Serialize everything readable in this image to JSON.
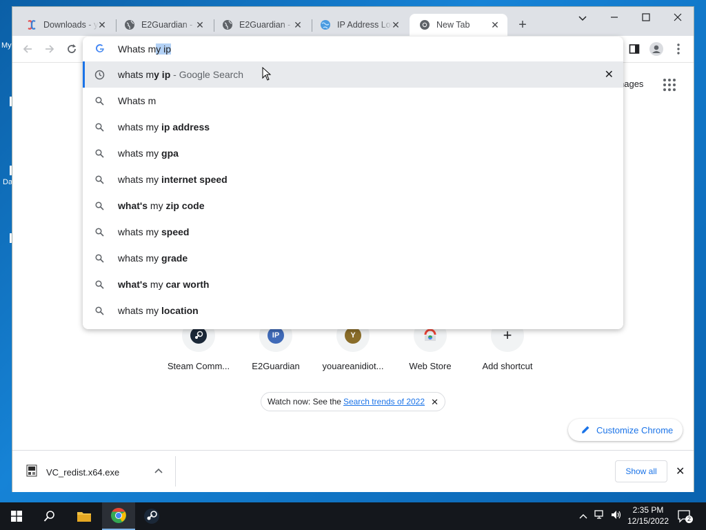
{
  "desktop": {
    "icon_labels": [
      "My",
      "Da"
    ]
  },
  "tabs": [
    {
      "title": "Downloads - y",
      "icon": "downloads-app-icon"
    },
    {
      "title": "E2Guardian - U",
      "icon": "globe-icon"
    },
    {
      "title": "E2Guardian - U",
      "icon": "globe-icon"
    },
    {
      "title": "IP Address Loc",
      "icon": "ip-globe-icon"
    },
    {
      "title": "New Tab",
      "icon": "chrome-icon"
    }
  ],
  "omnibox": {
    "typed": "Whats m",
    "autocomplete_selected": "y ip",
    "suggestions": [
      {
        "icon": "history-clock-icon",
        "prefix": "whats m",
        "bold": "y ip",
        "suffix": " - Google Search",
        "highlighted": true
      },
      {
        "icon": "search-icon",
        "prefix": "Whats m",
        "bold": "",
        "suffix": ""
      },
      {
        "icon": "search-icon",
        "prefix": "whats m",
        "plain_mid": "y ",
        "bold": "ip address",
        "suffix": ""
      },
      {
        "icon": "search-icon",
        "prefix": "whats m",
        "plain_mid": "y ",
        "bold": "gpa",
        "suffix": ""
      },
      {
        "icon": "search-icon",
        "prefix": "whats m",
        "plain_mid": "y ",
        "bold": "internet speed",
        "suffix": ""
      },
      {
        "icon": "search-icon",
        "bold_pre": "what's ",
        "prefix": "m",
        "plain_mid": "y ",
        "bold": "zip code",
        "suffix": ""
      },
      {
        "icon": "search-icon",
        "prefix": "whats m",
        "plain_mid": "y ",
        "bold": "speed",
        "suffix": ""
      },
      {
        "icon": "search-icon",
        "prefix": "whats m",
        "plain_mid": "y ",
        "bold": "grade",
        "suffix": ""
      },
      {
        "icon": "search-icon",
        "bold_pre": "what's ",
        "prefix": "m",
        "plain_mid": "y ",
        "bold": "car worth",
        "suffix": ""
      },
      {
        "icon": "search-icon",
        "prefix": "whats m",
        "plain_mid": "y ",
        "bold": "location",
        "suffix": ""
      }
    ]
  },
  "newtab": {
    "images_link": "nages",
    "shortcuts": [
      {
        "label": "Steam Comm...",
        "letter": "",
        "color": "#1b2838"
      },
      {
        "label": "E2Guardian",
        "letter": "IP",
        "color": "#3f6ab8"
      },
      {
        "label": "youareanidiot...",
        "letter": "Y",
        "color": "#8a6d2a"
      },
      {
        "label": "Web Store",
        "letter": "",
        "color": "#f1f3f4"
      },
      {
        "label": "Add shortcut",
        "letter": "+",
        "color": "#f1f3f4"
      }
    ],
    "watch_prefix": "Watch now: See the",
    "watch_link": "Search trends of 2022",
    "customize_label": "Customize Chrome"
  },
  "downloads": {
    "file_name": "VC_redist.x64.exe",
    "show_all_label": "Show all"
  },
  "taskbar": {
    "time": "2:35 PM",
    "date": "12/15/2022",
    "notification_count": "2"
  },
  "colors": {
    "accent": "#1a73e8",
    "taskbar": "#14171c",
    "tabstrip": "#dee1e6"
  }
}
